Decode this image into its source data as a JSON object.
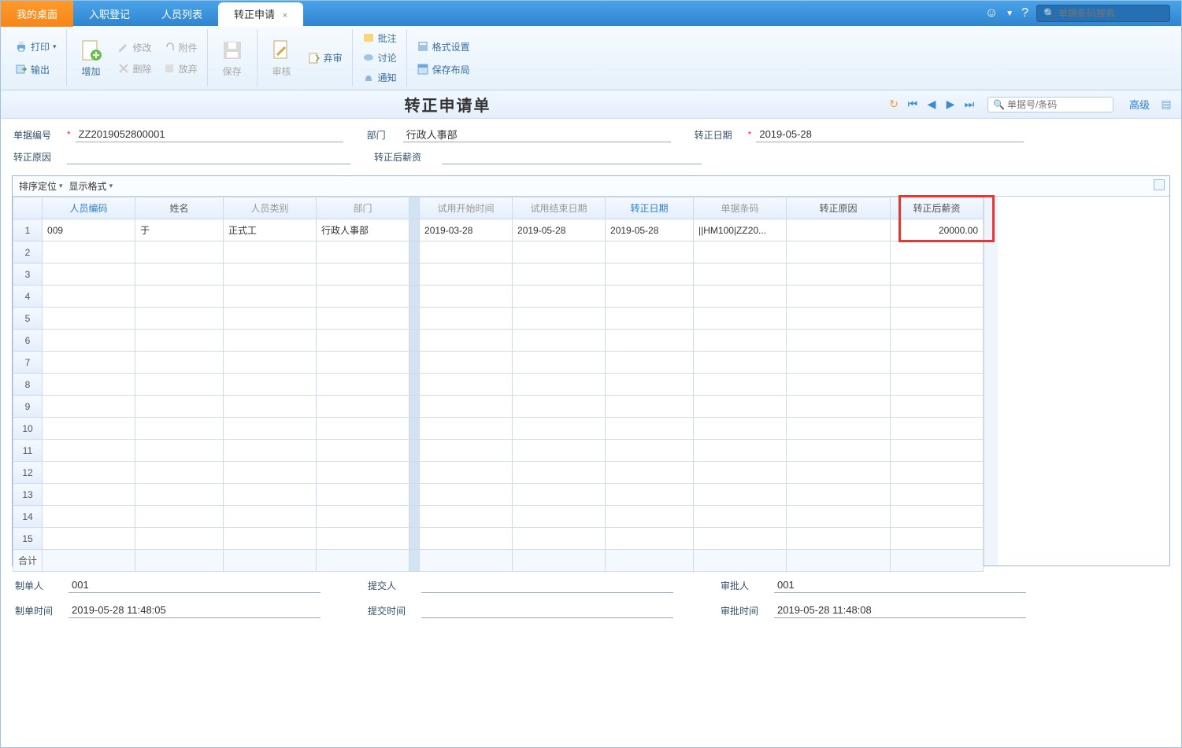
{
  "tabs": {
    "desktop": "我的桌面",
    "onboard": "入职登记",
    "personlist": "人员列表",
    "zhengzhuan": "转正申请"
  },
  "topSearch": {
    "placeholder": "单据条码搜索"
  },
  "toolbar": {
    "print": "打印",
    "output": "输出",
    "add": "增加",
    "modify": "修改",
    "delete": "删除",
    "attach": "附件",
    "discard": "放弃",
    "save": "保存",
    "audit": "审核",
    "abandon": "弃审",
    "note": "批注",
    "discuss": "讨论",
    "notify": "通知",
    "formatset": "格式设置",
    "savelayout": "保存布局"
  },
  "formTitle": "转正申请单",
  "docSearch": {
    "placeholder": "单据号/条码"
  },
  "advanced": "高级",
  "form": {
    "docnoLabel": "单据编号",
    "docno": "ZZ2019052800001",
    "deptLabel": "部门",
    "dept": "行政人事部",
    "dateLabel": "转正日期",
    "date": "2019-05-28",
    "reasonLabel": "转正原因",
    "reason": "",
    "postSalaryLabel": "转正后薪资",
    "postSalary": ""
  },
  "gridToolbar": {
    "sort": "排序定位",
    "display": "显示格式"
  },
  "grid": {
    "headers": {
      "barcode_hidden": "",
      "personCode": "人员编码",
      "name": "姓名",
      "personType": "人员类别",
      "dept": "部门",
      "trialStart": "试用开始时间",
      "trialEnd": "试用结束日期",
      "zzDate": "转正日期",
      "barcode": "单据条码",
      "reason": "转正原因",
      "postSalary": "转正后薪资"
    },
    "rows": [
      {
        "personCode": "009",
        "name": "于",
        "personType": "正式工",
        "dept": "行政人事部",
        "trialStart": "2019-03-28",
        "trialEnd": "2019-05-28",
        "zzDate": "2019-05-28",
        "barcode": "||HM100|ZZ20...",
        "reason": "",
        "postSalary": "20000.00"
      }
    ],
    "totalLabel": "合计",
    "emptyRows": 14
  },
  "footer": {
    "makerLabel": "制单人",
    "maker": "001",
    "makeTimeLabel": "制单时间",
    "makeTime": "2019-05-28 11:48:05",
    "submitterLabel": "提交人",
    "submitter": "",
    "submitTimeLabel": "提交时间",
    "submitTime": "",
    "approverLabel": "审批人",
    "approver": "001",
    "approveTimeLabel": "审批时间",
    "approveTime": "2019-05-28 11:48:08"
  }
}
